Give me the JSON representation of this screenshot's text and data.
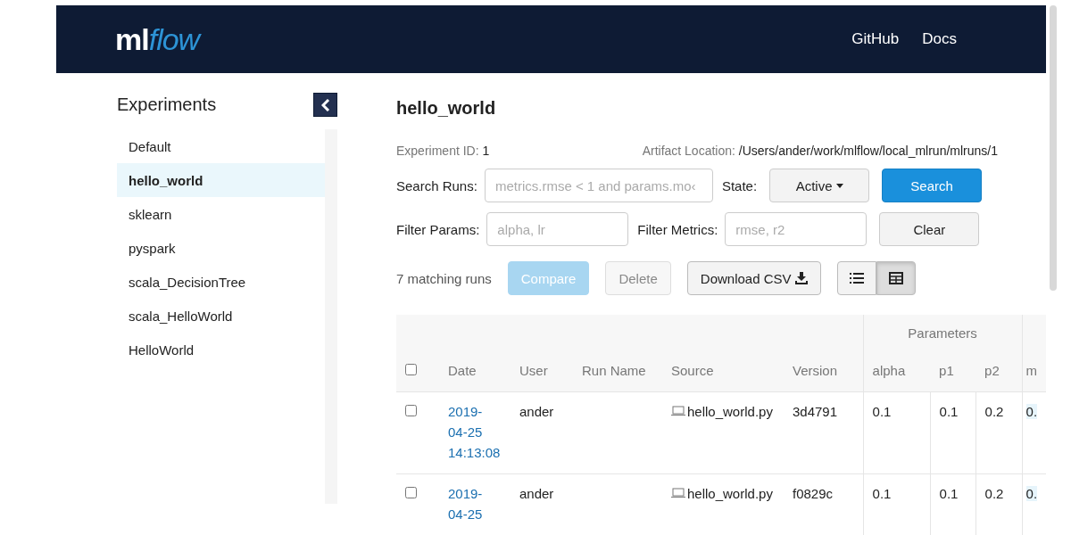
{
  "header": {
    "logo": {
      "part_1": "ml",
      "part_2": "flow"
    },
    "links": [
      "GitHub",
      "Docs"
    ]
  },
  "sidebar": {
    "title": "Experiments",
    "items": [
      {
        "label": "Default",
        "selected": false
      },
      {
        "label": "hello_world",
        "selected": true
      },
      {
        "label": "sklearn",
        "selected": false
      },
      {
        "label": "pyspark",
        "selected": false
      },
      {
        "label": "scala_DecisionTree",
        "selected": false
      },
      {
        "label": "scala_HelloWorld",
        "selected": false
      },
      {
        "label": "HelloWorld",
        "selected": false
      }
    ]
  },
  "experiment": {
    "title": "hello_world",
    "id_label": "Experiment ID:",
    "id_value": "1",
    "artifact_label": "Artifact Location:",
    "artifact_value": "/Users/ander/work/mlflow/local_mlrun/mlruns/1"
  },
  "search": {
    "search_label": "Search Runs:",
    "search_placeholder": "metrics.rmse < 1 and params.mo‹",
    "state_label": "State:",
    "state_value": "Active",
    "search_button": "Search",
    "params_label": "Filter Params:",
    "params_placeholder": "alpha, lr",
    "metrics_label": "Filter Metrics:",
    "metrics_placeholder": "rmse, r2",
    "clear_button": "Clear"
  },
  "toolbar": {
    "count": "7 matching runs",
    "buttons": [
      {
        "label": "Compare",
        "kind": "primary",
        "disabled": true
      },
      {
        "label": "Delete",
        "kind": "default",
        "disabled": true
      },
      {
        "label": "Download CSV",
        "kind": "download",
        "disabled": false
      }
    ],
    "views": [
      {
        "kind": "list",
        "selected": false
      },
      {
        "kind": "grid",
        "selected": true
      }
    ]
  },
  "table": {
    "group": "Parameters",
    "header_checked": false,
    "columns": [
      "Date",
      "User",
      "Run Name",
      "Source",
      "Version",
      "alpha",
      "p1",
      "p2",
      "m"
    ],
    "rows": [
      {
        "checked": false,
        "cells": [
          "2019-04-25 14:13:08",
          "ander",
          "",
          "hello_world.py",
          "3d4791",
          "0.1",
          "0.1",
          "0.2",
          "0."
        ]
      },
      {
        "checked": false,
        "cells": [
          "2019-04-25",
          "ander",
          "",
          "hello_world.py",
          "f0829c",
          "0.1",
          "0.1",
          "0.2",
          "0."
        ]
      }
    ]
  }
}
